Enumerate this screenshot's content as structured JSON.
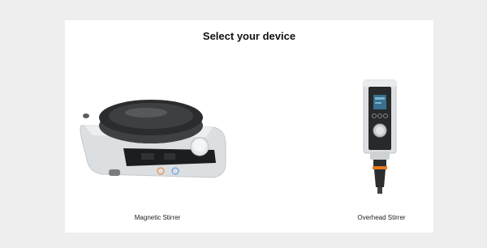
{
  "dialog": {
    "title": "Select your device",
    "devices": [
      {
        "label": "Magnetic Stirrer",
        "image": "magnetic-stirrer-product-photo"
      },
      {
        "label": "Overhead Stirrer",
        "image": "overhead-stirrer-product-photo"
      }
    ]
  },
  "colors": {
    "page_background": "#eeeeee",
    "dialog_background": "#ffffff",
    "title_text": "#111111",
    "label_text": "#222222",
    "accent_orange": "#e87a1e"
  }
}
